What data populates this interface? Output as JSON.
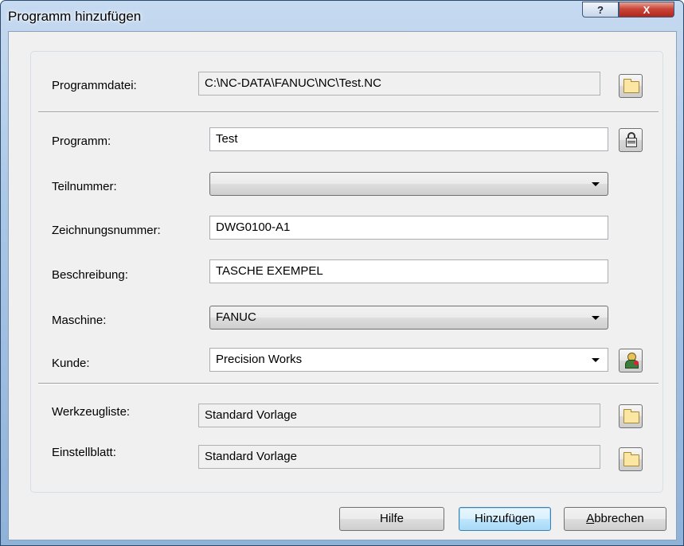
{
  "window": {
    "title": "Programm hinzufügen",
    "help_glyph": "?",
    "close_glyph": "X"
  },
  "form": {
    "programmdatei": {
      "label": "Programmdatei:",
      "value": "C:\\NC-DATA\\FANUC\\NC\\Test.NC",
      "icon": "folder-icon"
    },
    "programm": {
      "label": "Programm:",
      "value": "Test",
      "icon": "lock-icon"
    },
    "teilnummer": {
      "label": "Teilnummer:",
      "value": ""
    },
    "zeichnungsnummer": {
      "label": "Zeichnungsnummer:",
      "value": "DWG0100-A1"
    },
    "beschreibung": {
      "label": "Beschreibung:",
      "value": "TASCHE EXEMPEL"
    },
    "maschine": {
      "label": "Maschine:",
      "value": "FANUC"
    },
    "kunde": {
      "label": "Kunde:",
      "value": "Precision Works",
      "icon": "customer-icon"
    },
    "werkzeugliste": {
      "label": "Werkzeugliste:",
      "value": "Standard Vorlage",
      "icon": "folder-icon"
    },
    "einstellblatt": {
      "label": "Einstellblatt:",
      "value": "Standard Vorlage",
      "icon": "folder-icon"
    }
  },
  "buttons": {
    "hilfe": "Hilfe",
    "hinzufuegen": "Hinzufügen",
    "abbrechen_mnemonic": "A",
    "abbrechen_rest": "bbrechen"
  }
}
